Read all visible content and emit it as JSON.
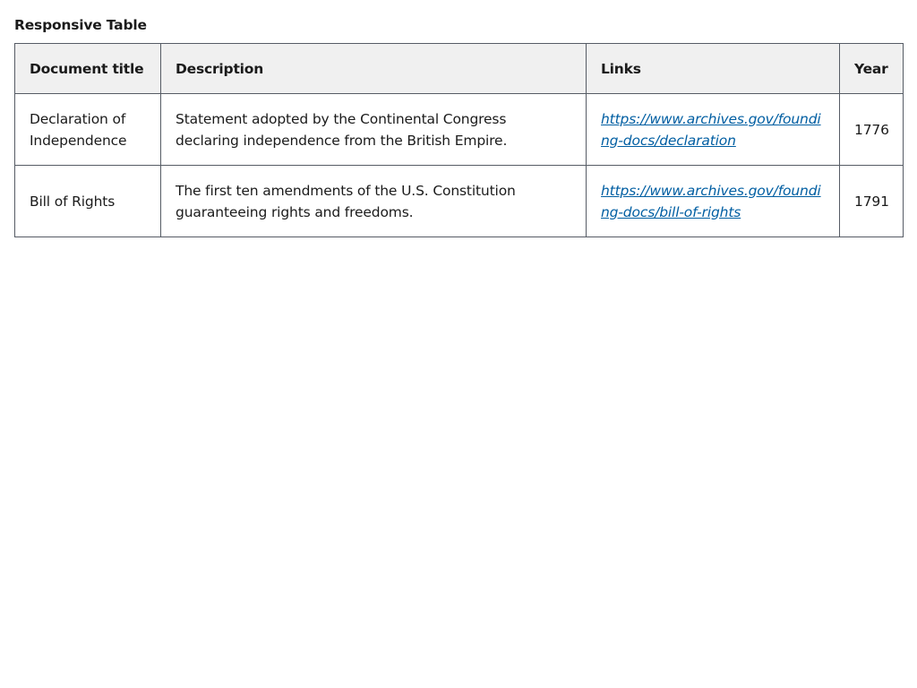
{
  "caption": "Responsive Table",
  "table": {
    "headers": [
      "Document title",
      "Description",
      "Links",
      "Year"
    ],
    "rows": [
      {
        "title": "Declaration of Independence",
        "description": "Statement adopted by the Continental Congress declaring independence from the British Empire.",
        "link": "https://www.archives.gov/founding-docs/declaration",
        "year": "1776"
      },
      {
        "title": "Bill of Rights",
        "description": "The first ten amendments of the U.S. Constitution guaranteeing rights and freedoms.",
        "link": "https://www.archives.gov/founding-docs/bill-of-rights",
        "year": "1791"
      }
    ]
  },
  "colors": {
    "link": "#005ea2",
    "header_bg": "#f0f0f0",
    "border": "#565c65"
  }
}
